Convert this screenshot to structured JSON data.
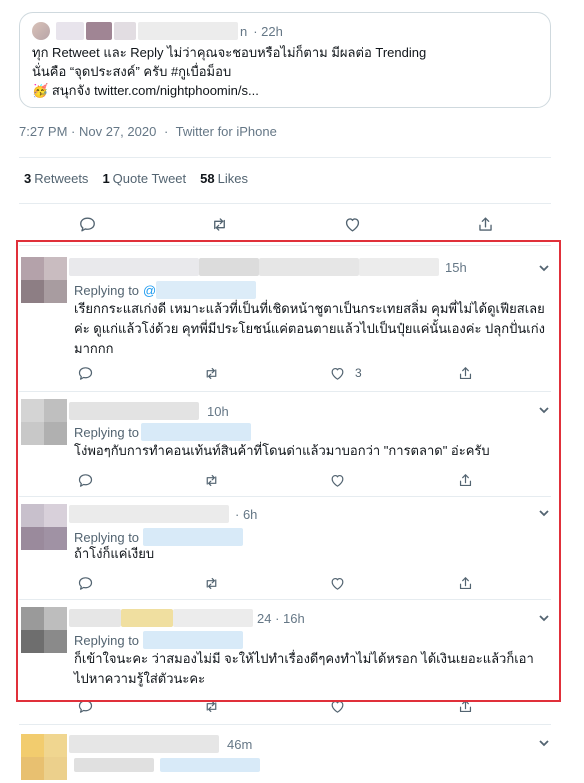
{
  "quoted_tweet": {
    "time": "· 22h",
    "handle_tail": "n",
    "line1": "ทุก Retweet และ Reply ไม่ว่าคุณจะชอบหรือไม่ก็ตาม มีผลต่อ Trending",
    "line2": "นั่นคือ “จุดประสงค์” ครับ #กูเบื่อม็อบ",
    "line3_emoji": "🥳",
    "line3": "สนุกจัง twitter.com/nightphoomin/s..."
  },
  "meta": {
    "timestamp": "7:27 PM · Nov 27, 2020",
    "separator": "·",
    "source": "Twitter for iPhone"
  },
  "stats": {
    "retweets_count": "3",
    "retweets_label": "Retweets",
    "quotes_count": "1",
    "quotes_label": "Quote Tweet",
    "likes_count": "58",
    "likes_label": "Likes"
  },
  "main_actions": [
    "reply-icon",
    "retweet-icon",
    "like-icon",
    "share-icon"
  ],
  "replies": [
    {
      "time": "15h",
      "replying_prefix": "Replying to",
      "replying_handle": "@",
      "text": "เรียกกระแสเก่งดี เหมาะแล้วที่เป็นที่เชิดหน้าชูตาเป็นกระเทยสลิ่ม คุมพี่ไม่ได้ดูเฟียสเลยค่ะ ดูแก่แล้วโง่ด้วย คุทพี่มีประโยชน์แค่ตอนตายแล้วไปเป็นปุ๋ยแค่นั้นเองค่ะ ปลุกปั่นเก่งมากกก",
      "like_count": "3"
    },
    {
      "time": "10h",
      "replying_prefix": "Replying to",
      "text": "โง่พอๆกับการทำคอนเท้นท์สินค้าที่โดนด่าแล้วมาบอกว่า \"การตลาด\" อ่ะครับ"
    },
    {
      "time": "· 6h",
      "replying_prefix": "Replying to",
      "text": "ถ้าโง่ก็แค่เงียบ"
    },
    {
      "time": "24 · 16h",
      "replying_prefix": "Replying to",
      "text": "ก็เข้าใจนะคะ ว่าสมองไม่มี จะให้ไปทำเรื่องดีๆคงทำไม่ได้หรอก ได้เงินเยอะแล้วก็เอาไปหาความรู้ใส่ตัวนะคะ"
    },
    {
      "time": "46m"
    }
  ],
  "colors": {
    "highlight": "#e0303a",
    "text": "#0f1419",
    "secondary": "#536471",
    "mention": "#1d9bf0",
    "border": "#cfd9de"
  }
}
